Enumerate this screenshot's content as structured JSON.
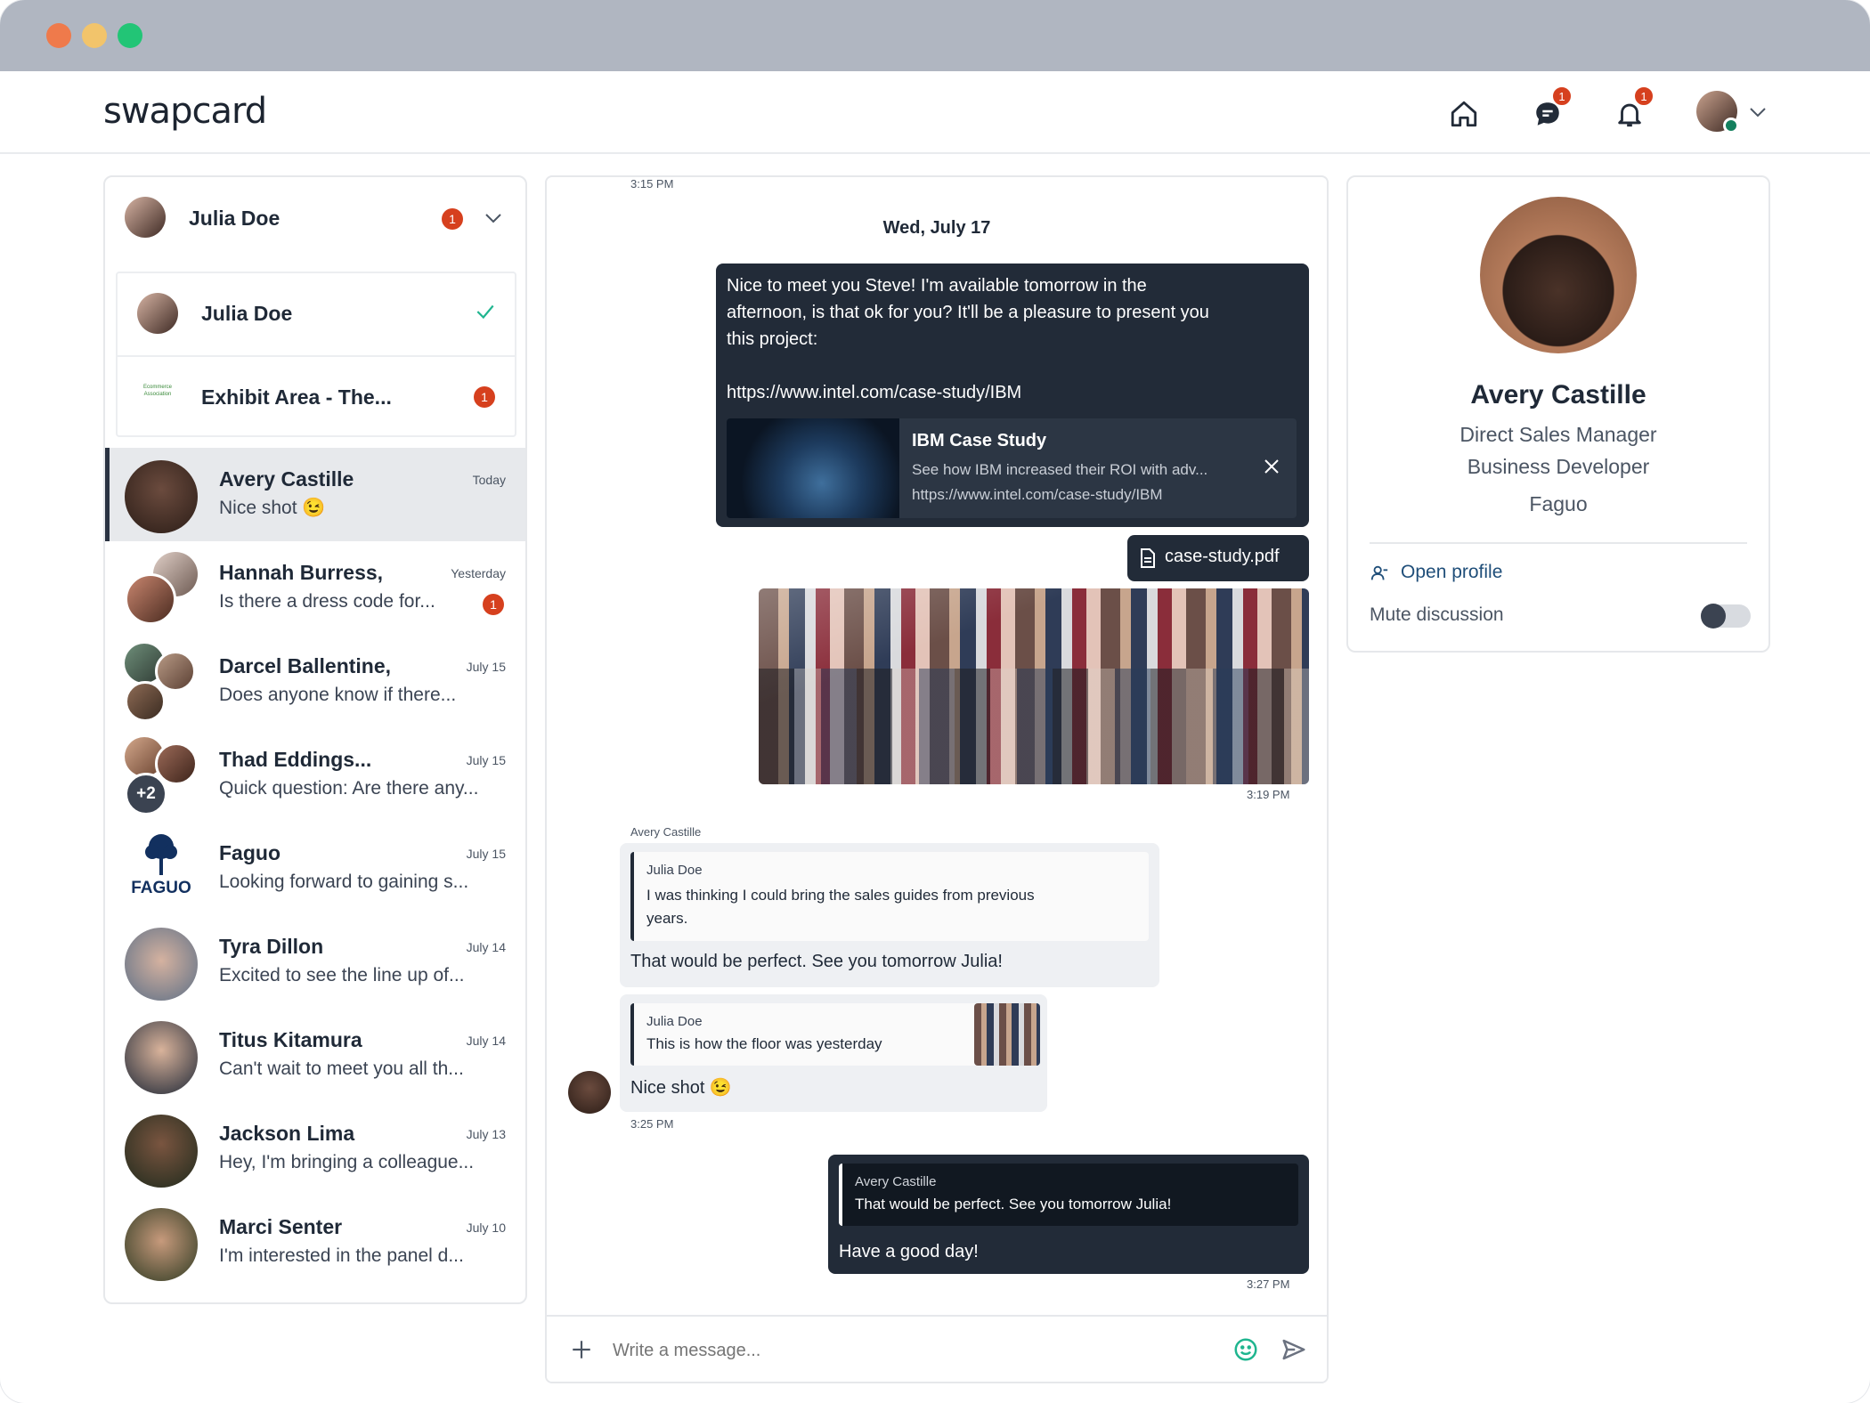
{
  "app": {
    "logo": "swapcard"
  },
  "window": {
    "controls": [
      "close",
      "minimize",
      "maximize"
    ]
  },
  "nav": {
    "icons": [
      "home-icon",
      "chat-icon",
      "bell-icon"
    ],
    "messages_badge": "1",
    "notifications_badge": "1"
  },
  "account_switcher": {
    "current": "Julia Doe",
    "badge": "1",
    "options": [
      {
        "label": "Julia Doe",
        "selected": true
      },
      {
        "label": "Exhibit Area - The...",
        "badge": "1"
      }
    ],
    "logo_text": "Ecommerce Association"
  },
  "conversations": [
    {
      "name": "Avery Castille",
      "preview": "Nice shot 😉",
      "date": "Today",
      "active": true
    },
    {
      "name": "Hannah Burress,",
      "preview": "Is there a dress code for...",
      "date": "Yesterday",
      "badge": "1"
    },
    {
      "name": "Darcel Ballentine,",
      "preview": "Does anyone know if there...",
      "date": "July 15"
    },
    {
      "name": "Thad Eddings...",
      "preview": "Quick question: Are there any...",
      "date": "July 15",
      "extra": "+2"
    },
    {
      "name": "Faguo",
      "preview": "Looking forward to gaining s...",
      "date": "July 15",
      "logo": "FAGUO"
    },
    {
      "name": "Tyra Dillon",
      "preview": "Excited to see the line up of...",
      "date": "July 14"
    },
    {
      "name": "Titus Kitamura",
      "preview": "Can't wait to meet you all th...",
      "date": "July 14"
    },
    {
      "name": "Jackson Lima",
      "preview": "Hey, I'm bringing a colleague...",
      "date": "July 13"
    },
    {
      "name": "Marci Senter",
      "preview": "I'm interested in the panel d...",
      "date": "July 10"
    }
  ],
  "chat": {
    "top_time": "3:15 PM",
    "day_label": "Wed, July 17",
    "msg1": {
      "line1": "Nice to meet you Steve! I'm available tomorrow in the",
      "line2": "afternoon, is that ok for you? It'll be a pleasure to present you",
      "line3": "this project:",
      "url": "https://www.intel.com/case-study/IBM"
    },
    "link_preview": {
      "title": "IBM Case Study",
      "desc": "See how IBM increased their ROI with adv...",
      "url": "https://www.intel.com/case-study/IBM"
    },
    "attachment": "case-study.pdf",
    "photo_time": "3:19 PM",
    "sender": "Avery Castille",
    "reply1": {
      "quote_author": "Julia Doe",
      "quote_line1": "I was thinking I could bring the sales guides from previous",
      "quote_line2": "years.",
      "text": "That would be perfect. See you tomorrow Julia!"
    },
    "reply2": {
      "quote_author": "Julia Doe",
      "quote_text": "This is how the floor was yesterday",
      "text": "Nice shot 😉"
    },
    "reply_time": "3:25 PM",
    "reply3": {
      "quote_author": "Avery Castille",
      "quote_text": "That would be perfect. See you tomorrow Julia!",
      "text": "Have a good day!"
    },
    "last_time": "3:27 PM",
    "composer_placeholder": "Write a message..."
  },
  "profile": {
    "name": "Avery Castille",
    "title1": "Direct Sales Manager",
    "title2": "Business Developer",
    "company": "Faguo",
    "open_profile": "Open profile",
    "mute_label": "Mute discussion",
    "muted": false
  },
  "colors": {
    "accent": "#1fb58f",
    "dark": "#222b38",
    "badge": "#d6401e",
    "titlebar": "#b0b6c1"
  }
}
